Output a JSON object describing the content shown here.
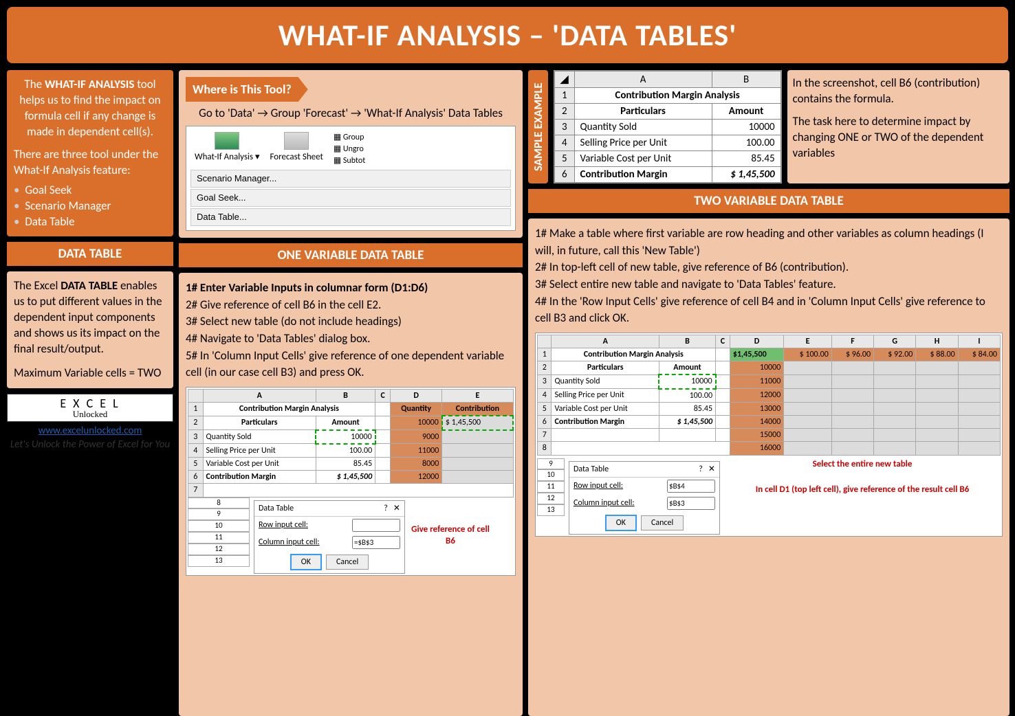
{
  "title": "WHAT-IF ANALYSIS – 'DATA TABLES'",
  "intro": {
    "part1": "The ",
    "bold1": "WHAT-IF ANALYSIS",
    "part2": " tool helps us to find the impact on formula cell if any change is made in dependent cell(s).",
    "sub": "There are three tool under the What-If Analysis feature:",
    "items": [
      "Goal Seek",
      "Scenario Manager",
      "Data Table"
    ]
  },
  "dt_hdr": "DATA TABLE",
  "dt_body1": "The Excel ",
  "dt_bold": "DATA TABLE",
  "dt_body2": " enables us to put different values in the dependent input components and shows us its impact on the final result/output.",
  "dt_max": "Maximum Variable cells = TWO",
  "logo": {
    "line1": "E X C E L",
    "line2": "Unlocked",
    "site": "www.excelunlocked.com",
    "tag": "Let's Unlock the Power of Excel for You"
  },
  "where": {
    "tab": "Where is This Tool?",
    "path": "Go to 'Data' → Group 'Forecast' → 'What-If Analysis' Data Tables",
    "btn1": "What-If Analysis ▾",
    "btn2": "Forecast Sheet",
    "opt_g": "Group",
    "opt_u": "Ungro",
    "opt_s": "Subtot",
    "m1": "Scenario Manager...",
    "m2": "Goal Seek...",
    "m3": "Data Table..."
  },
  "sample": {
    "label": "SAMPLE EXAMPLE",
    "title": "Contribution Margin Analysis",
    "h1": "Particulars",
    "h2": "Amount",
    "r1": "Quantity Sold",
    "v1": "10000",
    "r2": "Selling Price per Unit",
    "v2": "100.00",
    "r3": "Variable Cost per Unit",
    "v3": "85.45",
    "r4": "Contribution Margin",
    "v4": "$ 1,45,500",
    "note1": "In the screenshot, cell B6 (contribution) contains the formula.",
    "note2": "The task here to determine impact by changing ONE or TWO of the dependent variables"
  },
  "one": {
    "hdr": "ONE VARIABLE DATA TABLE",
    "s1": "1# Enter Variable Inputs in columnar form (D1:D6)",
    "s2": "2# Give reference of cell B6 in the cell E2.",
    "s3": "3# Select new table (do not include headings)",
    "s4": "4# Navigate to 'Data Tables' dialog box.",
    "s5": "5# In 'Column Input Cells' give reference of one dependent variable cell (in our case cell B3) and press OK.",
    "qhdr": "Quantity",
    "chdr": "Contribution",
    "q": [
      "10000",
      "9000",
      "11000",
      "8000",
      "12000"
    ],
    "cval": "$   1,45,500",
    "dlg_t": "Data Table",
    "dlg_r": "Row input cell:",
    "dlg_c": "Column input cell:",
    "dlg_ci": "=$B$3",
    "ok": "OK",
    "cancel": "Cancel",
    "red": "Give reference of cell B6"
  },
  "two": {
    "hdr": "TWO VARIABLE DATA TABLE",
    "s1": "1# Make a table where first variable are row heading and other variables as column headings (I will, in future, call this 'New Table')",
    "s2": "2# In top-left cell of new table, give reference of B6 (contribution).",
    "s3": "3# Select entire new table and navigate to 'Data Tables' feature.",
    "s4": "4# In the 'Row Input Cells' give reference of cell B4 and in 'Column Input Cells' give reference to cell B3 and click OK.",
    "d1": "$1,45,500",
    "cols": [
      "$ 100.00",
      "$   96.00",
      "$   92.00",
      "$   88.00",
      "$   84.00"
    ],
    "rows": [
      "10000",
      "11000",
      "12000",
      "13000",
      "14000",
      "15000",
      "16000"
    ],
    "dlg_ri": "$B$4",
    "dlg_ci": "$B$3",
    "red1": "Select the entire new table",
    "red2": "In cell D1 (top left cell), give reference of the result cell B6"
  }
}
